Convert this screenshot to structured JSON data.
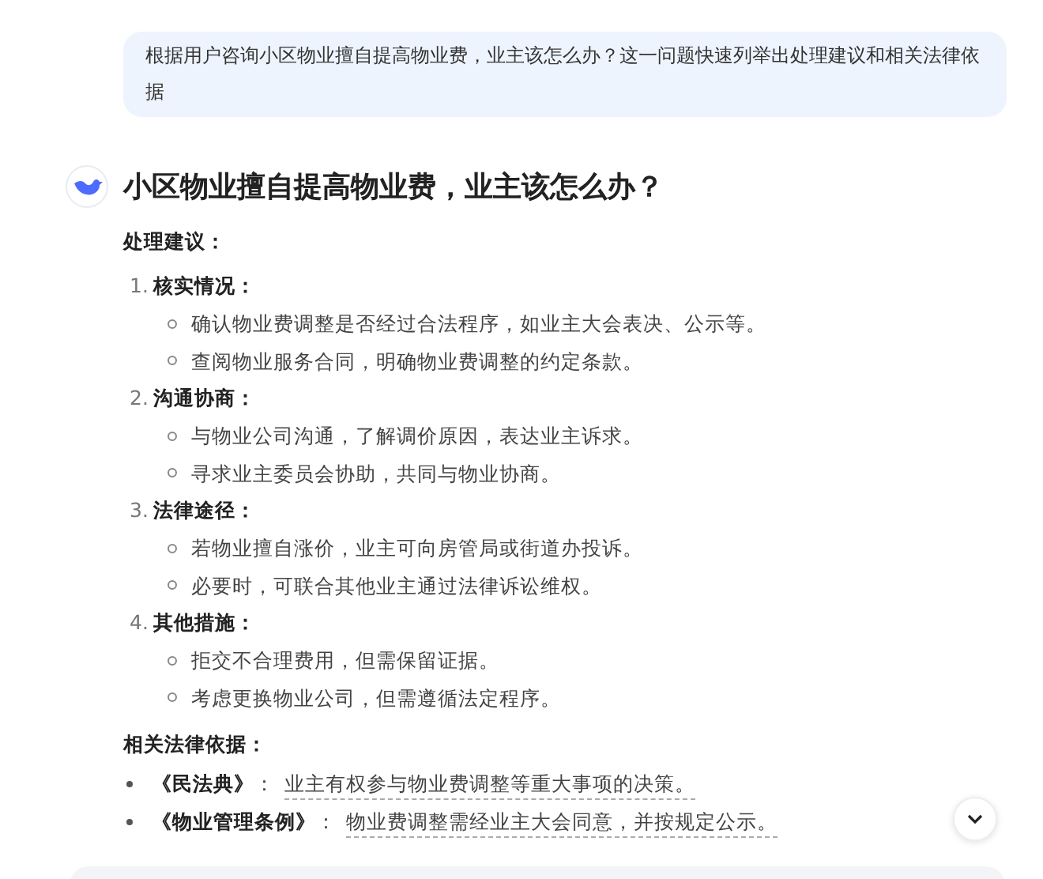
{
  "user_message": "根据用户咨询小区物业擅自提高物业费，业主该怎么办？这一问题快速列举出处理建议和相关法律依据",
  "answer": {
    "title": "小区物业擅自提高物业费，业主该怎么办？",
    "suggestions_heading": "处理建议：",
    "suggestions": [
      {
        "number": "1.",
        "title": "核实情况：",
        "points": [
          "确认物业费调整是否经过合法程序，如业主大会表决、公示等。",
          "查阅物业服务合同，明确物业费调整的约定条款。"
        ]
      },
      {
        "number": "2.",
        "title": "沟通协商：",
        "points": [
          "与物业公司沟通，了解调价原因，表达业主诉求。",
          "寻求业主委员会协助，共同与物业协商。"
        ]
      },
      {
        "number": "3.",
        "title": "法律途径：",
        "points": [
          "若物业擅自涨价，业主可向房管局或街道办投诉。",
          "必要时，可联合其他业主通过法律诉讼维权。"
        ]
      },
      {
        "number": "4.",
        "title": "其他措施：",
        "points": [
          "拒交不合理费用，但需保留证据。",
          "考虑更换物业公司，但需遵循法定程序。"
        ]
      }
    ],
    "law_heading": "相关法律依据：",
    "laws": [
      {
        "name": "《民法典》",
        "separator": "：",
        "text": "业主有权参与物业费调整等重大事项的决策。"
      },
      {
        "name": "《物业管理条例》",
        "separator": "：",
        "text": "物业费调整需经业主大会同意，并按规定公示。"
      }
    ]
  }
}
